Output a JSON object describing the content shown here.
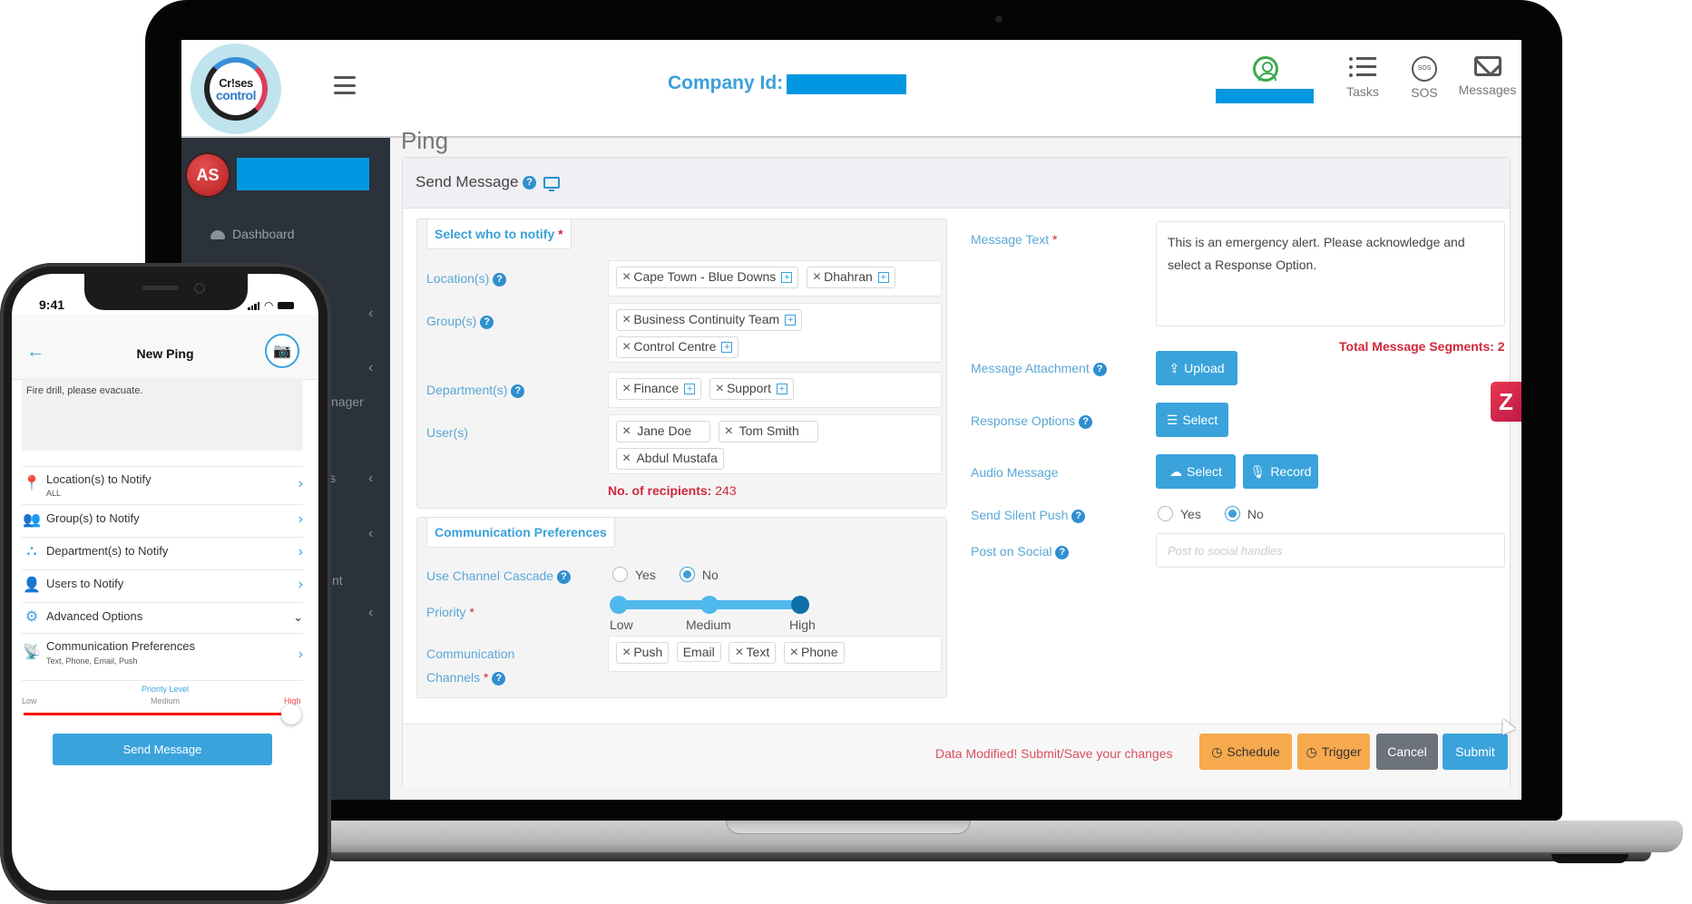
{
  "laptop": {
    "header": {
      "logo_line1": "Cr!ses",
      "logo_line2": "control",
      "company_id_label": "Company Id:",
      "nav": [
        {
          "label": "Tasks",
          "icon": "list-icon"
        },
        {
          "label": "SOS",
          "icon": "sos-icon",
          "icon_text": "SOS"
        },
        {
          "label": "Messages",
          "icon": "envelope-icon"
        }
      ]
    },
    "sidebar": {
      "avatar_initials": "AS",
      "dashboard_label": "Dashboard",
      "partial_labels": [
        "nager",
        "s",
        "nt"
      ],
      "chevron": "‹"
    },
    "page_title": "Ping",
    "panel_title": "Send Message",
    "help_glyph": "?",
    "notify": {
      "legend": "Select who to notify",
      "required_mark": "*",
      "locations_label": "Location(s)",
      "locations": [
        "Cape Town - Blue Downs",
        "Dhahran"
      ],
      "groups_label": "Group(s)",
      "groups": [
        "Business Continuity Team",
        "Control Centre"
      ],
      "departments_label": "Department(s)",
      "departments": [
        "Finance",
        "Support"
      ],
      "users_label": "User(s)",
      "users": [
        "Jane Doe",
        "Tom Smith",
        "Abdul Mustafa"
      ],
      "recipients_label": "No. of recipients:",
      "recipients_count": "243"
    },
    "comm": {
      "legend": "Communication Preferences",
      "cascade_label": "Use Channel Cascade",
      "yes": "Yes",
      "no": "No",
      "cascade_value": "No",
      "priority_label": "Priority",
      "priority_levels": [
        "Low",
        "Medium",
        "High"
      ],
      "priority_value": "High",
      "channels_label_1": "Communication",
      "channels_label_2": "Channels",
      "channels": [
        {
          "label": "Push",
          "removable": true
        },
        {
          "label": "Email",
          "removable": false
        },
        {
          "label": "Text",
          "removable": true
        },
        {
          "label": "Phone",
          "removable": true
        }
      ]
    },
    "message": {
      "text_label": "Message Text",
      "text_value": "This is an emergency alert. Please acknowledge and select a Response Option.",
      "segments": "Total Message Segments: 2",
      "attachment_label": "Message Attachment",
      "upload_label": "Upload",
      "response_label": "Response Options",
      "response_button": "Select",
      "audio_label": "Audio Message",
      "audio_select": "Select",
      "audio_record": "Record",
      "silent_push_label": "Send Silent Push",
      "silent_push_value": "No",
      "social_label": "Post on Social",
      "social_placeholder": "Post to social handles"
    },
    "footer": {
      "modified_msg": "Data Modified! Submit/Save your changes",
      "schedule": "Schedule",
      "trigger": "Trigger",
      "cancel": "Cancel",
      "submit": "Submit"
    },
    "colors": {
      "accent": "#3aa3dc",
      "danger": "#d0283a",
      "warning": "#f7a94d",
      "sidebar": "#2b323b",
      "redaction": "#0097e0"
    }
  },
  "phone": {
    "time": "9:41",
    "title": "New Ping",
    "message": "Fire drill, please evacuate.",
    "items": [
      {
        "label": "Location(s) to Notify",
        "sub": "ALL",
        "icon": "location-pin-icon"
      },
      {
        "label": "Group(s) to Notify",
        "sub": "",
        "icon": "group-icon"
      },
      {
        "label": "Department(s) to Notify",
        "sub": "",
        "icon": "org-chart-icon"
      },
      {
        "label": "Users to Notify",
        "sub": "",
        "icon": "user-icon"
      },
      {
        "label": "Advanced Options",
        "sub": "",
        "icon": "gear-icon"
      },
      {
        "label": "Communication Preferences",
        "sub": "Text, Phone, Email, Push",
        "icon": "antenna-icon"
      }
    ],
    "priority_title": "Priority Level",
    "priority_levels": [
      "Low",
      "Medium",
      "High"
    ],
    "priority_value": "High",
    "send_label": "Send Message"
  }
}
